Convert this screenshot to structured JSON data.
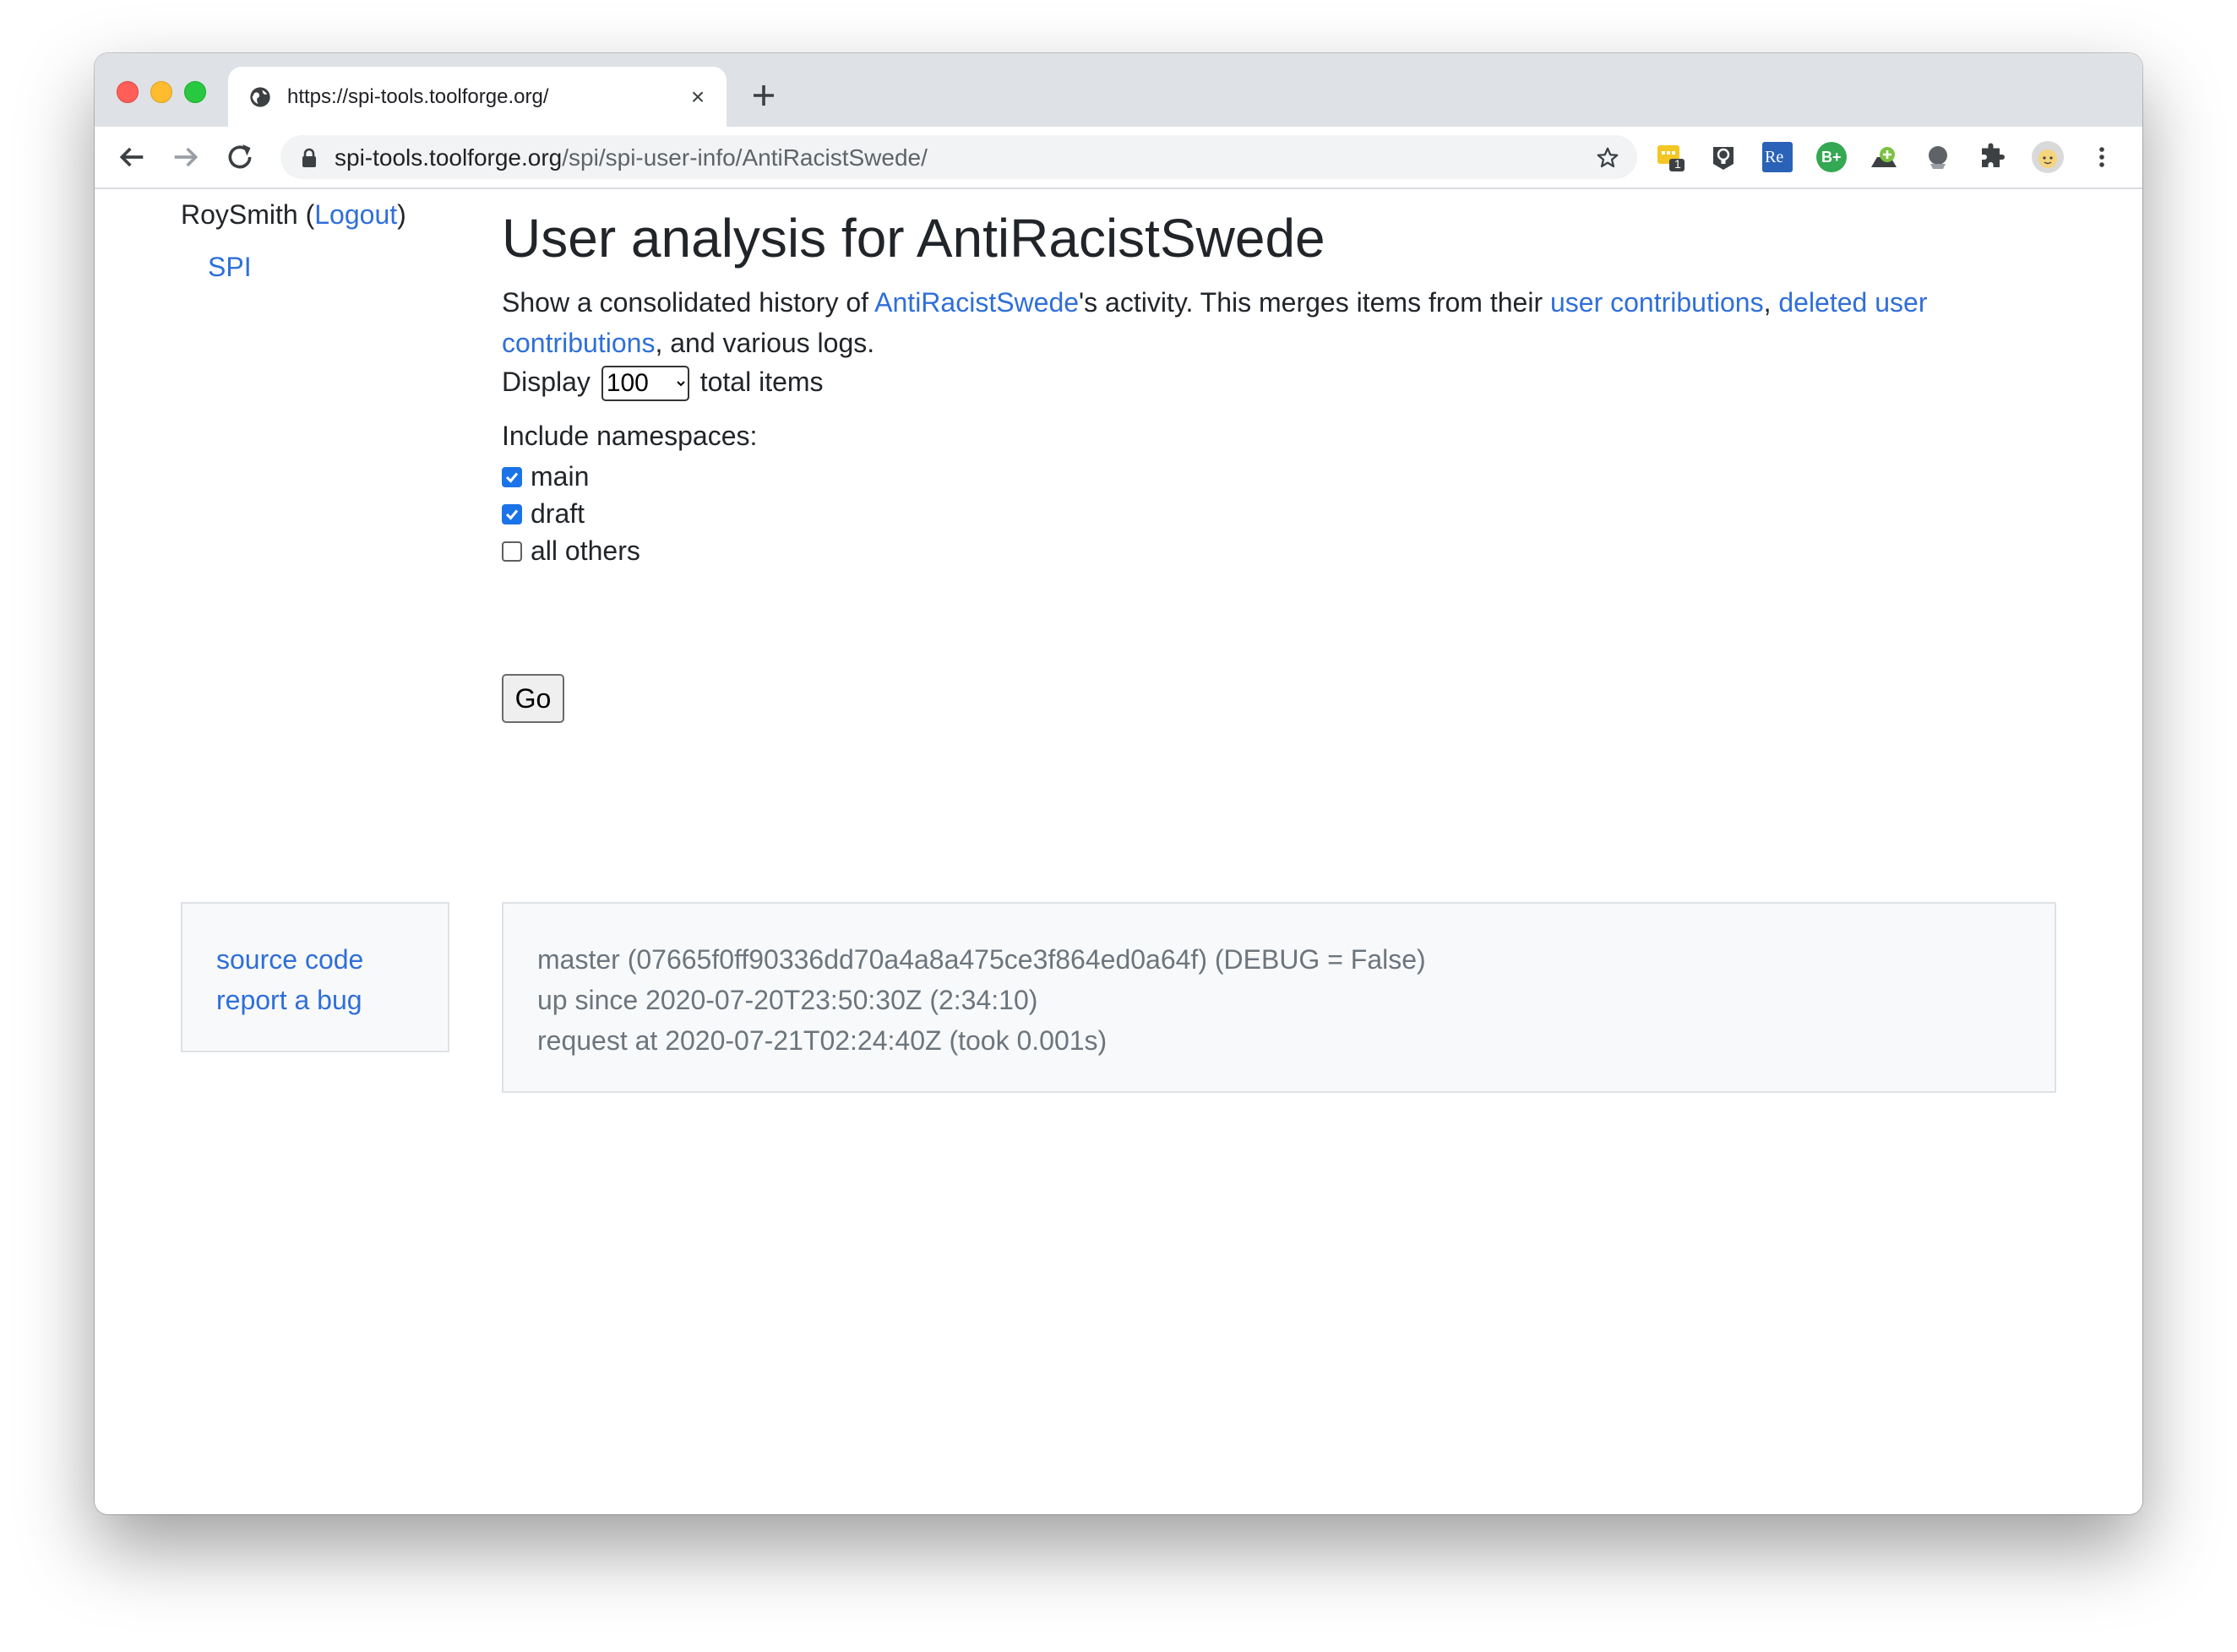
{
  "browser": {
    "tab_title": "https://spi-tools.toolforge.org/",
    "tab_close": "×",
    "url_host": "spi-tools.toolforge.org",
    "url_path": "/spi/spi-user-info/AntiRacistSwede/",
    "extension_badge": "1",
    "extension_re_label": "Re",
    "extension_bplus_label": "B+"
  },
  "sidebar": {
    "username": "RoySmith",
    "logout_open": " (",
    "logout_label": "Logout",
    "logout_close": ")",
    "nav_items": [
      {
        "label": "SPI"
      }
    ]
  },
  "main": {
    "title": "User analysis for AntiRacistSwede",
    "intro": {
      "part1": "Show a consolidated history of ",
      "user_link": "AntiRacistSwede",
      "part2": "'s activity. This merges items from their ",
      "contribs_link": "user contributions",
      "part3": ", ",
      "deleted_link": "deleted user contributions",
      "part4": ", and various logs."
    },
    "display": {
      "prefix": "Display",
      "selected": "100",
      "suffix": "total items"
    },
    "namespaces": {
      "label": "Include namespaces:",
      "items": [
        {
          "label": "main",
          "checked": true
        },
        {
          "label": "draft",
          "checked": true
        },
        {
          "label": "all others",
          "checked": false
        }
      ]
    },
    "go_label": "Go"
  },
  "footer": {
    "links": [
      {
        "label": "source code"
      },
      {
        "label": "report a bug"
      }
    ],
    "info_lines": [
      "master (07665f0ff90336dd70a4a8a475ce3f864ed0a64f) (DEBUG = False)",
      "up since 2020-07-20T23:50:30Z (2:34:10)",
      "request at 2020-07-21T02:24:40Z (took 0.001s)"
    ]
  },
  "colors": {
    "link": "#2f6fd8",
    "text": "#212529",
    "muted": "#6c757d",
    "checkbox_on": "#1a73e8",
    "tabstrip": "#dee1e6"
  },
  "icons": [
    "globe-icon",
    "close-icon",
    "plus-icon",
    "back-icon",
    "forward-icon",
    "reload-icon",
    "lock-icon",
    "star-icon",
    "puzzle-icon",
    "more-icon"
  ]
}
